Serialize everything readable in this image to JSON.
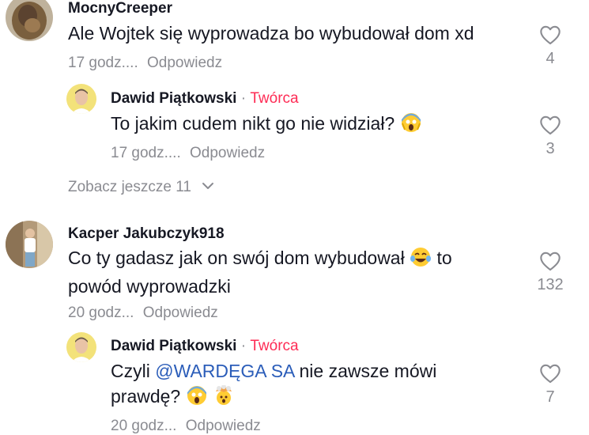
{
  "comments": [
    {
      "username": "MocnyCreeper",
      "text": "Ale Wojtek się wyprowadza bo wybudował dom xd",
      "time": "17 godz....",
      "reply_label": "Odpowiedz",
      "likes": "4",
      "reply": {
        "username": "Dawid Piątkowski",
        "separator": "·",
        "badge": "Twórca",
        "text": "To jakim cudem nikt go nie widział?",
        "emoji": [
          "scream-emoji"
        ],
        "time": "17 godz....",
        "reply_label": "Odpowiedz",
        "likes": "3"
      },
      "more_replies": "Zobacz jeszcze 11"
    },
    {
      "username": "Kacper Jakubczyk918",
      "text_part1": "Co ty gadasz jak on swój dom wybudował",
      "text_part2": "to",
      "text_line2": "powód wyprowadzki",
      "emoji": [
        "laughing-tears-emoji"
      ],
      "time": "20 godz...",
      "reply_label": "Odpowiedz",
      "likes": "132",
      "reply": {
        "username": "Dawid Piątkowski",
        "separator": "·",
        "badge": "Twórca",
        "text_part1": "Czyli",
        "mention": "@WARDĘGA SA",
        "text_part2": "nie zawsze mówi",
        "text_line2": "prawdę?",
        "emoji": [
          "scream-emoji",
          "exploding-head-emoji"
        ],
        "time": "20 godz...",
        "reply_label": "Odpowiedz",
        "likes": "7"
      }
    }
  ],
  "colors": {
    "creator_badge": "#fe2c55",
    "mention": "#2b5db9",
    "meta_text": "#8a8b91"
  }
}
